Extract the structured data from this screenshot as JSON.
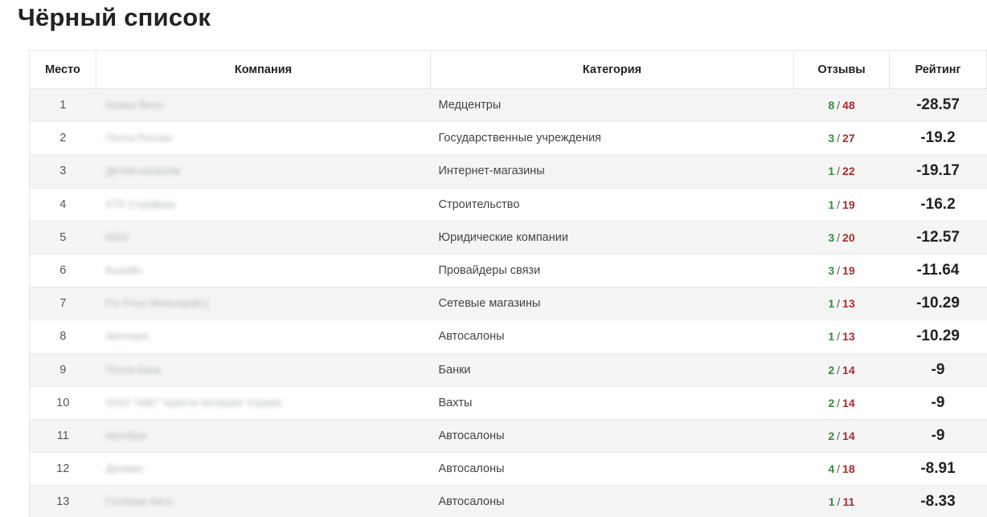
{
  "page_title": "Чёрный список",
  "columns": {
    "place": "Место",
    "company": "Компания",
    "category": "Категория",
    "reviews": "Отзывы",
    "rating": "Рейтинг"
  },
  "rows": [
    {
      "place": "1",
      "company": "Алмаз Вита",
      "category": "Медцентры",
      "pos": "8",
      "neg": "48",
      "rating": "-28.57"
    },
    {
      "place": "2",
      "company": "Почта России",
      "category": "Государственные учреждения",
      "pos": "3",
      "neg": "27",
      "rating": "-19.2"
    },
    {
      "place": "3",
      "company": "Детям каналом",
      "category": "Интернет-магазины",
      "pos": "1",
      "neg": "22",
      "rating": "-19.17"
    },
    {
      "place": "4",
      "company": "СТК Строймах",
      "category": "Строительство",
      "pos": "1",
      "neg": "19",
      "rating": "-16.2"
    },
    {
      "place": "5",
      "company": "КЮС",
      "category": "Юридические компании",
      "pos": "3",
      "neg": "20",
      "rating": "-12.57"
    },
    {
      "place": "6",
      "company": "Билайн",
      "category": "Провайдеры связи",
      "pos": "3",
      "neg": "19",
      "rating": "-11.64"
    },
    {
      "place": "7",
      "company": "Fix Price (Фикспрайс)",
      "category": "Сетевые магазины",
      "pos": "1",
      "neg": "13",
      "rating": "-10.29"
    },
    {
      "place": "8",
      "company": "Автогруп",
      "category": "Автосалоны",
      "pos": "1",
      "neg": "13",
      "rating": "-10.29"
    },
    {
      "place": "9",
      "company": "Почта Банк",
      "category": "Банки",
      "pos": "2",
      "neg": "14",
      "rating": "-9"
    },
    {
      "place": "10",
      "company": "ООО \"АВС\" Кристи Кетеринг Сервис",
      "category": "Вахты",
      "pos": "2",
      "neg": "14",
      "rating": "-9"
    },
    {
      "place": "11",
      "company": "Автобум",
      "category": "Автосалоны",
      "pos": "2",
      "neg": "14",
      "rating": "-9"
    },
    {
      "place": "12",
      "company": "Динамо",
      "category": "Автосалоны",
      "pos": "4",
      "neg": "18",
      "rating": "-8.91"
    },
    {
      "place": "13",
      "company": "Глобиум Авто",
      "category": "Автосалоны",
      "pos": "1",
      "neg": "11",
      "rating": "-8.33"
    }
  ],
  "colors": {
    "positive": "#3a8a3a",
    "negative": "#b02a2a",
    "row_alt": "#f5f5f5"
  }
}
